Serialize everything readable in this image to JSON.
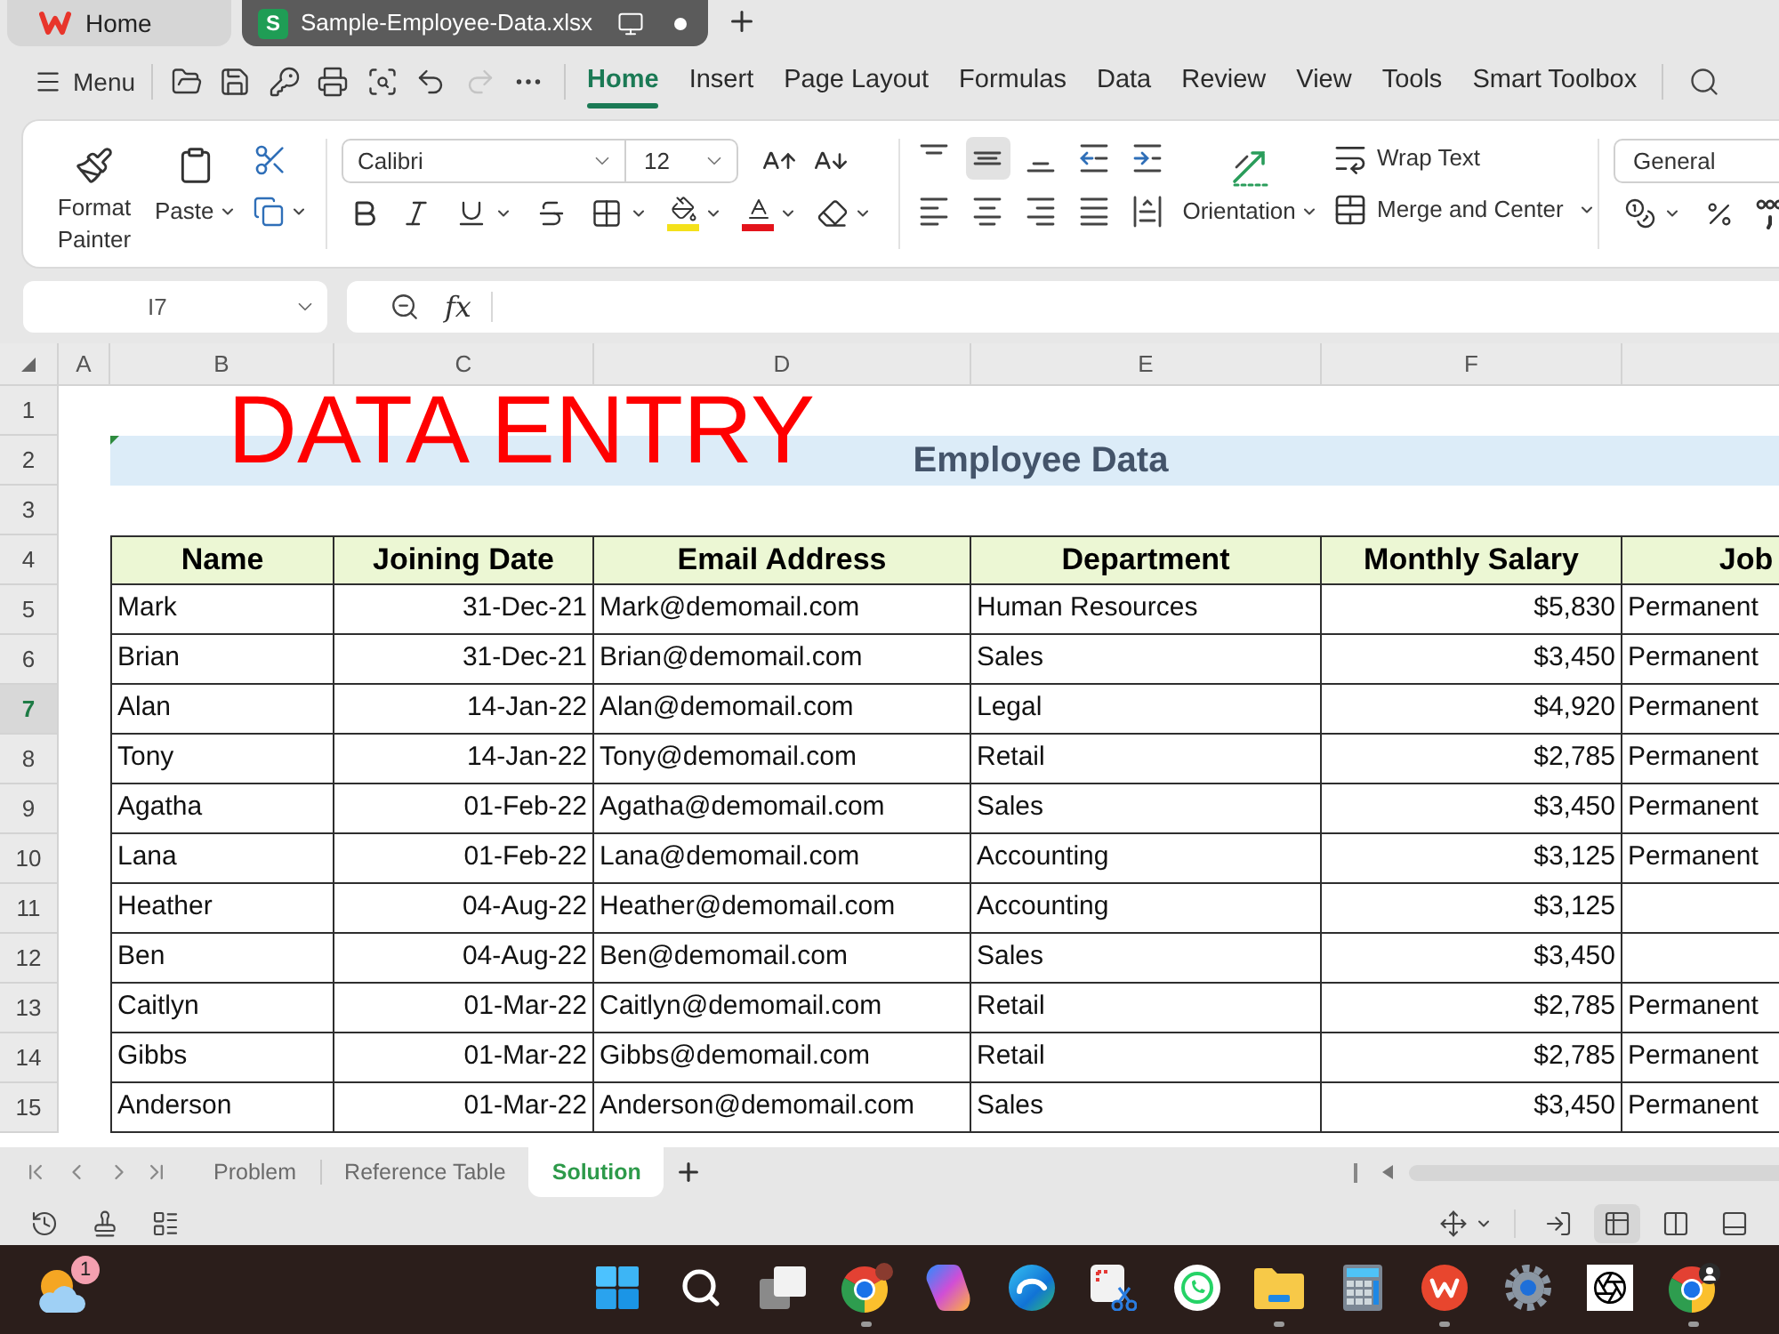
{
  "window_tabs": [
    {
      "kind": "home",
      "label": "Home",
      "selected": false
    },
    {
      "kind": "file",
      "icon_letter": "S",
      "label": "Sample-Employee-Data.xlsx",
      "selected": true
    }
  ],
  "menu_label": "Menu",
  "quick_access": [
    {
      "kind": "open",
      "disabled": false
    },
    {
      "kind": "save",
      "disabled": false
    },
    {
      "kind": "share",
      "disabled": false
    },
    {
      "kind": "print",
      "disabled": false
    },
    {
      "kind": "preview",
      "disabled": false
    },
    {
      "kind": "undo",
      "disabled": false
    },
    {
      "kind": "redo",
      "disabled": true
    },
    {
      "kind": "more",
      "disabled": false
    }
  ],
  "ribbon_tabs": [
    {
      "label": "Home",
      "selected": true
    },
    {
      "label": "Insert",
      "selected": false
    },
    {
      "label": "Page Layout",
      "selected": false
    },
    {
      "label": "Formulas",
      "selected": false
    },
    {
      "label": "Data",
      "selected": false
    },
    {
      "label": "Review",
      "selected": false
    },
    {
      "label": "View",
      "selected": false
    },
    {
      "label": "Tools",
      "selected": false
    },
    {
      "label": "Smart Toolbox",
      "selected": false
    }
  ],
  "ribbon": {
    "format_painter": "Format Painter",
    "paste": "Paste",
    "font": {
      "value": "Calibri"
    },
    "font_size": {
      "value": "12"
    },
    "vertical_alignment": [
      {
        "kind": "top",
        "selected": false
      },
      {
        "kind": "middle",
        "selected": true
      },
      {
        "kind": "bottom",
        "selected": false
      }
    ],
    "orientation": "Orientation",
    "wrap_text": "Wrap Text",
    "merge_and_center": "Merge and Center",
    "number_format": {
      "value": "General"
    }
  },
  "name_box": {
    "value": "I7"
  },
  "formula_bar": {
    "function_label": "fx"
  },
  "sheet": {
    "column_headers": [
      "A",
      "B",
      "C",
      "D",
      "E",
      "F"
    ],
    "row_headers": [
      {
        "label": "1",
        "selected": false
      },
      {
        "label": "2",
        "selected": false
      },
      {
        "label": "3",
        "selected": false
      },
      {
        "label": "4",
        "selected": false
      },
      {
        "label": "5",
        "selected": false
      },
      {
        "label": "6",
        "selected": false
      },
      {
        "label": "7",
        "selected": true
      },
      {
        "label": "8",
        "selected": false
      },
      {
        "label": "9",
        "selected": false
      },
      {
        "label": "10",
        "selected": false
      },
      {
        "label": "11",
        "selected": false
      },
      {
        "label": "12",
        "selected": false
      },
      {
        "label": "13",
        "selected": false
      },
      {
        "label": "14",
        "selected": false
      },
      {
        "label": "15",
        "selected": false
      }
    ],
    "title": "DATA ENTRY",
    "subtitle": "Employee Data",
    "table": {
      "columns": [
        {
          "label": "Name",
          "kind": "text"
        },
        {
          "label": "Joining Date",
          "kind": "date"
        },
        {
          "label": "Email Address",
          "kind": "text"
        },
        {
          "label": "Department",
          "kind": "text"
        },
        {
          "label": "Monthly Salary",
          "kind": "currency"
        },
        {
          "label": "Job",
          "kind": "text"
        }
      ],
      "rows": [
        [
          "Mark",
          "31-Dec-21",
          "Mark@demomail.com",
          "Human Resources",
          "$5,830",
          "Permanent"
        ],
        [
          "Brian",
          "31-Dec-21",
          "Brian@demomail.com",
          "Sales",
          "$3,450",
          "Permanent"
        ],
        [
          "Alan",
          "14-Jan-22",
          "Alan@demomail.com",
          "Legal",
          "$4,920",
          "Permanent"
        ],
        [
          "Tony",
          "14-Jan-22",
          "Tony@demomail.com",
          "Retail",
          "$2,785",
          "Permanent"
        ],
        [
          "Agatha",
          "01-Feb-22",
          "Agatha@demomail.com",
          "Sales",
          "$3,450",
          "Permanent"
        ],
        [
          "Lana",
          "01-Feb-22",
          "Lana@demomail.com",
          "Accounting",
          "$3,125",
          "Permanent"
        ],
        [
          "Heather",
          "04-Aug-22",
          "Heather@demomail.com",
          "Accounting",
          "$3,125"
        ],
        [
          "Ben",
          "04-Aug-22",
          "Ben@demomail.com",
          "Sales",
          "$3,450"
        ],
        [
          "Caitlyn",
          "01-Mar-22",
          "Caitlyn@demomail.com",
          "Retail",
          "$2,785",
          "Permanent"
        ],
        [
          "Gibbs",
          "01-Mar-22",
          "Gibbs@demomail.com",
          "Retail",
          "$2,785",
          "Permanent"
        ],
        [
          "Anderson",
          "01-Mar-22",
          "Anderson@demomail.com",
          "Sales",
          "$3,450",
          "Permanent"
        ]
      ]
    }
  },
  "sheet_tabs": [
    {
      "label": "Problem",
      "selected": false
    },
    {
      "label": "Reference Table",
      "selected": false
    },
    {
      "label": "Solution",
      "selected": true
    }
  ],
  "status_bar": {
    "view_modes": [
      {
        "kind": "reading",
        "selected": false
      },
      {
        "kind": "normal",
        "selected": true
      },
      {
        "kind": "split",
        "selected": false
      },
      {
        "kind": "layout",
        "selected": false
      }
    ]
  },
  "taskbar": {
    "weather_badge": "1",
    "apps": [
      {
        "kind": "start",
        "running": false
      },
      {
        "kind": "search",
        "running": false
      },
      {
        "kind": "task_view",
        "running": false
      },
      {
        "kind": "chrome",
        "running": true
      },
      {
        "kind": "copilot",
        "running": false
      },
      {
        "kind": "edge",
        "running": false
      },
      {
        "kind": "snip",
        "running": false
      },
      {
        "kind": "whatsapp",
        "running": false
      },
      {
        "kind": "explorer",
        "running": true
      },
      {
        "kind": "calculator",
        "running": false
      },
      {
        "kind": "wps",
        "running": true
      },
      {
        "kind": "settings",
        "running": false
      },
      {
        "kind": "chatgpt",
        "running": false
      },
      {
        "kind": "chrome_profile",
        "running": true
      }
    ]
  }
}
